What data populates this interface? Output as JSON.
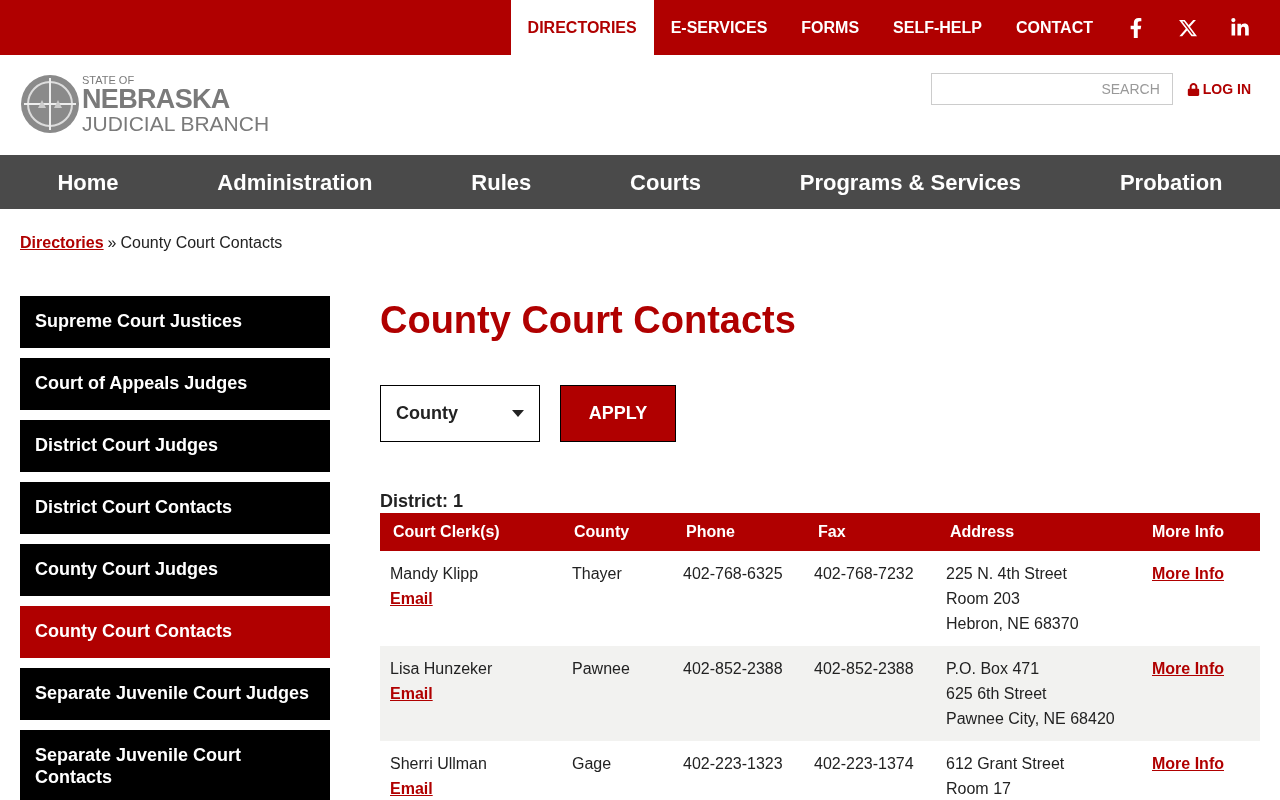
{
  "top_nav": [
    {
      "label": "DIRECTORIES",
      "selected": true
    },
    {
      "label": "E-SERVICES",
      "selected": false
    },
    {
      "label": "FORMS",
      "selected": false
    },
    {
      "label": "SELF-HELP",
      "selected": false
    },
    {
      "label": "CONTACT",
      "selected": false
    }
  ],
  "social": [
    {
      "kind": "facebook"
    },
    {
      "kind": "x"
    },
    {
      "kind": "linkedin"
    }
  ],
  "logo": {
    "line_1": "STATE OF",
    "line_2": "NEBRASKA",
    "line_3": "JUDICIAL BRANCH"
  },
  "search": {
    "placeholder": "SEARCH"
  },
  "login": "LOG IN",
  "main_nav": [
    "Home",
    "Administration",
    "Rules",
    "Courts",
    "Programs & Services",
    "Probation"
  ],
  "breadcrumb": {
    "link": "Directories",
    "separator": "»",
    "current": "County Court Contacts"
  },
  "sidebar": [
    {
      "label": "Supreme Court Justices",
      "selected": false
    },
    {
      "label": "Court of Appeals Judges",
      "selected": false
    },
    {
      "label": "District Court Judges",
      "selected": false
    },
    {
      "label": "District Court Contacts",
      "selected": false
    },
    {
      "label": "County Court Judges",
      "selected": false
    },
    {
      "label": "County Court Contacts",
      "selected": true
    },
    {
      "label": "Separate Juvenile Court Judges",
      "selected": false
    },
    {
      "label": "Separate Juvenile Court Contacts",
      "selected": false
    }
  ],
  "title": "County Court Contacts",
  "filter": {
    "value": "County",
    "button": "APPLY"
  },
  "district": "District: 1",
  "table": {
    "columns": [
      "Court Clerk(s)",
      "County",
      "Phone",
      "Fax",
      "Address",
      "More Info"
    ],
    "rows": [
      {
        "clerk": "Mandy Klipp",
        "email": "Email",
        "county": "Thayer",
        "phone": "402-768-6325",
        "fax": "402-768-7232",
        "address": [
          "225 N. 4th Street",
          "Room 203",
          "Hebron, NE 68370"
        ],
        "more": "More Info"
      },
      {
        "clerk": "Lisa Hunzeker",
        "email": "Email",
        "county": "Pawnee",
        "phone": "402-852-2388",
        "fax": "402-852-2388",
        "address": [
          "P.O. Box 471",
          "625 6th Street",
          "Pawnee City, NE 68420"
        ],
        "more": "More Info"
      },
      {
        "clerk": "Sherri Ullman",
        "email": "Email",
        "county": "Gage",
        "phone": "402-223-1323",
        "fax": "402-223-1374",
        "address": [
          "612 Grant Street",
          "Room 17"
        ],
        "more": "More Info"
      }
    ]
  }
}
